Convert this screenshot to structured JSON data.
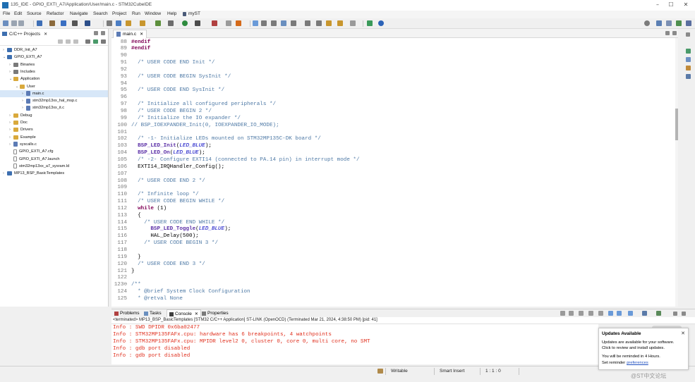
{
  "window": {
    "title": "135_IDE - GPIO_EXTI_A7/Application/User/main.c - STM32CubeIDE",
    "minimize": "–",
    "maximize": "☐",
    "close": "✕"
  },
  "menu": [
    "File",
    "Edit",
    "Source",
    "Refactor",
    "Navigate",
    "Search",
    "Project",
    "Run",
    "Window",
    "Help",
    "myST"
  ],
  "project_explorer": {
    "tab_label": "C/C++ Projects",
    "tree": [
      {
        "label": "DDR_Init_A7",
        "icon": "project",
        "chev": "›",
        "depth": 0
      },
      {
        "label": "GPIO_EXTI_A7",
        "icon": "project",
        "chev": "⌄",
        "depth": 0
      },
      {
        "label": "Binaries",
        "icon": "lib",
        "chev": "›",
        "depth": 1
      },
      {
        "label": "Includes",
        "icon": "lib",
        "chev": "›",
        "depth": 1
      },
      {
        "label": "Application",
        "icon": "folder",
        "chev": "⌄",
        "depth": 1
      },
      {
        "label": "User",
        "icon": "folder",
        "chev": "⌄",
        "depth": 2
      },
      {
        "label": "main.c",
        "icon": "cfile",
        "chev": "›",
        "depth": 3,
        "selected": true
      },
      {
        "label": "stm32mp13xx_hal_msp.c",
        "icon": "cfile",
        "chev": "›",
        "depth": 3
      },
      {
        "label": "stm32mp13xx_it.c",
        "icon": "cfile",
        "chev": "›",
        "depth": 3
      },
      {
        "label": "Debug",
        "icon": "folder",
        "chev": "›",
        "depth": 1
      },
      {
        "label": "Doc",
        "icon": "folder",
        "chev": "›",
        "depth": 1
      },
      {
        "label": "Drivers",
        "icon": "folder",
        "chev": "›",
        "depth": 1
      },
      {
        "label": "Example",
        "icon": "folder",
        "chev": "›",
        "depth": 1
      },
      {
        "label": "syscalls.c",
        "icon": "cfile",
        "chev": "›",
        "depth": 1
      },
      {
        "label": "GPIO_EXTI_A7.cfg",
        "icon": "file",
        "chev": "",
        "depth": 1
      },
      {
        "label": "GPIO_EXTI_A7.launch",
        "icon": "file",
        "chev": "",
        "depth": 1
      },
      {
        "label": "stm32mp13xx_a7_sysram.ld",
        "icon": "file",
        "chev": "",
        "depth": 1
      },
      {
        "label": "MP13_BSP_BasicTemplates",
        "icon": "project",
        "chev": "›",
        "depth": 0
      }
    ]
  },
  "editor": {
    "tab_label": "main.c",
    "lines": [
      {
        "n": "88",
        "segs": [
          [
            "#endif",
            "pre"
          ]
        ]
      },
      {
        "n": "89",
        "segs": [
          [
            "#endif",
            "pre"
          ]
        ]
      },
      {
        "n": "90",
        "segs": []
      },
      {
        "n": "91",
        "segs": [
          [
            "  /* USER CODE END Init */",
            "comment"
          ]
        ]
      },
      {
        "n": "92",
        "segs": []
      },
      {
        "n": "93",
        "segs": [
          [
            "  /* USER CODE BEGIN SysInit */",
            "comment"
          ]
        ]
      },
      {
        "n": "94",
        "segs": []
      },
      {
        "n": "95",
        "segs": [
          [
            "  /* USER CODE END SysInit */",
            "comment"
          ]
        ]
      },
      {
        "n": "96",
        "segs": []
      },
      {
        "n": "97",
        "segs": [
          [
            "  /* Initialize all configured peripherals */",
            "comment"
          ]
        ]
      },
      {
        "n": "98",
        "segs": [
          [
            "  /* USER CODE BEGIN 2 */",
            "comment"
          ]
        ]
      },
      {
        "n": "99",
        "segs": [
          [
            "  /* Initialize the IO expander */",
            "comment"
          ]
        ]
      },
      {
        "n": "100",
        "segs": [
          [
            "// BSP_IOEXPANDER_Init(0, IOEXPANDER_IO_MODE);",
            "comment"
          ]
        ]
      },
      {
        "n": "101",
        "segs": []
      },
      {
        "n": "102",
        "segs": [
          [
            "  /* -1- Initialize LEDs mounted on STM32MP135C-DK board */",
            "comment"
          ]
        ]
      },
      {
        "n": "103",
        "segs": [
          [
            "  ",
            "plain"
          ],
          [
            "BSP_LED_Init",
            "macro"
          ],
          [
            "(",
            "plain"
          ],
          [
            "LED_BLUE",
            "it"
          ],
          [
            ");",
            "plain"
          ]
        ]
      },
      {
        "n": "104",
        "segs": [
          [
            "  ",
            "plain"
          ],
          [
            "BSP_LED_On",
            "macro"
          ],
          [
            "(",
            "plain"
          ],
          [
            "LED_BLUE",
            "it"
          ],
          [
            ");",
            "plain"
          ]
        ]
      },
      {
        "n": "105",
        "segs": [
          [
            "  /* -2- Configure EXTI14 (connected to PA.14 pin) in interrupt mode */",
            "comment"
          ]
        ]
      },
      {
        "n": "106",
        "segs": [
          [
            "  EXTI14_IRQHandler_Config();",
            "plain"
          ]
        ]
      },
      {
        "n": "107",
        "segs": []
      },
      {
        "n": "108",
        "segs": [
          [
            "  /* USER CODE END 2 */",
            "comment"
          ]
        ]
      },
      {
        "n": "109",
        "segs": []
      },
      {
        "n": "110",
        "segs": [
          [
            "  /* Infinite loop */",
            "comment"
          ]
        ]
      },
      {
        "n": "111",
        "segs": [
          [
            "  /* USER CODE BEGIN WHILE */",
            "comment"
          ]
        ]
      },
      {
        "n": "112",
        "segs": [
          [
            "  ",
            "plain"
          ],
          [
            "while",
            "kw"
          ],
          [
            " (1)",
            "plain"
          ]
        ]
      },
      {
        "n": "113",
        "segs": [
          [
            "  {",
            "plain"
          ]
        ]
      },
      {
        "n": "114",
        "segs": [
          [
            "    /* USER CODE END WHILE */",
            "comment"
          ]
        ]
      },
      {
        "n": "115",
        "segs": [
          [
            "      ",
            "plain"
          ],
          [
            "BSP_LED_Toggle",
            "macro"
          ],
          [
            "(",
            "plain"
          ],
          [
            "LED_BLUE",
            "it"
          ],
          [
            ");",
            "plain"
          ]
        ]
      },
      {
        "n": "116",
        "segs": [
          [
            "      HAL_Delay(500);",
            "plain"
          ]
        ]
      },
      {
        "n": "117",
        "segs": [
          [
            "    /* USER CODE BEGIN 3 */",
            "comment"
          ]
        ]
      },
      {
        "n": "118",
        "segs": []
      },
      {
        "n": "119",
        "segs": [
          [
            "  }",
            "plain"
          ]
        ]
      },
      {
        "n": "120",
        "segs": [
          [
            "  /* USER CODE END 3 */",
            "comment"
          ]
        ]
      },
      {
        "n": "121",
        "segs": [
          [
            "}",
            "plain"
          ]
        ]
      },
      {
        "n": "122",
        "segs": []
      },
      {
        "n": "123⊖",
        "segs": [
          [
            "/**",
            "comment"
          ]
        ]
      },
      {
        "n": "124",
        "segs": [
          [
            "  * @brief System Clock Configuration",
            "comment"
          ]
        ]
      },
      {
        "n": "125",
        "segs": [
          [
            "  * @retval None",
            "comment"
          ]
        ]
      }
    ]
  },
  "bottom_panel": {
    "tabs": [
      "Problems",
      "Tasks",
      "Console",
      "Properties"
    ],
    "console_header": "<terminated> MP13_BSP_BasicTemplates [STM32 C/C++ Application] ST-LINK (OpenOCD) (Terminated Mar 21, 2024, 4:38:50 PM) [pid: 41]",
    "console_lines": [
      "Info : SWD DPIDR 0x6ba02477",
      "Info : STM32MP135FAFx.cpu: hardware has 6 breakpoints, 4 watchpoints",
      "Info : STM32MP135FAFx.cpu: MPIDR level2 0, cluster 0, core 0, multi core, no SMT",
      "Info : gdb port disabled",
      "Info : gdb port disabled"
    ]
  },
  "statusbar": {
    "writable": "Writable",
    "insert_mode": "Smart Insert",
    "position": "1 : 1 : 0"
  },
  "notification": {
    "title": "Updates Available",
    "close": "✕",
    "lines": [
      "Updates are available for your software.",
      "Click to review and install updates.",
      "You will be reminded in 4 Hours.",
      "Set reminder "
    ],
    "link": "preferences"
  },
  "watermark": "@ST中文论坛",
  "colors": {
    "comment": "#4f7aa6",
    "keyword": "#7f0055",
    "console_text": "#e0301e",
    "selection": "#d7e7f8"
  }
}
